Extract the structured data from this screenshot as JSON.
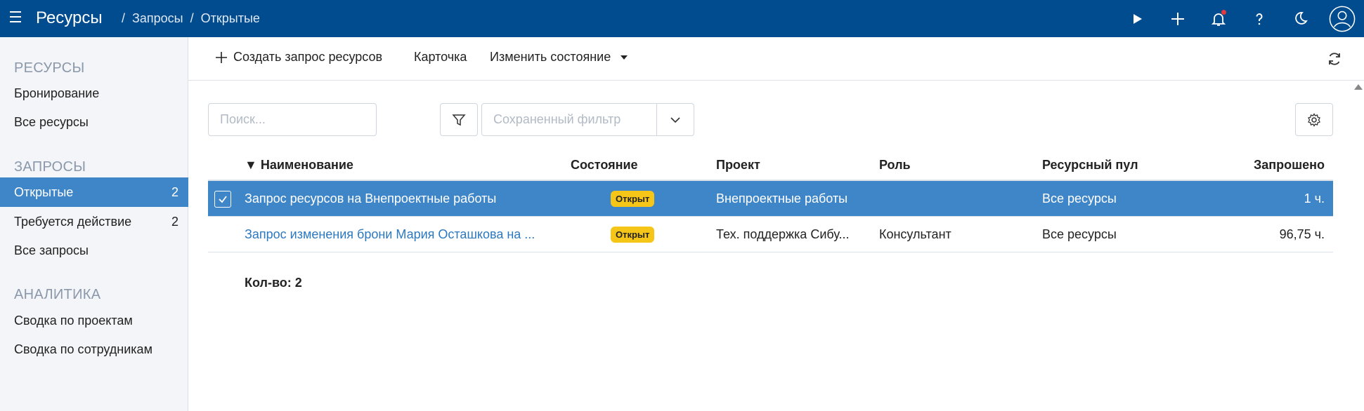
{
  "header": {
    "app_title": "Ресурсы",
    "breadcrumb": [
      "Запросы",
      "Открытые"
    ],
    "separator": "/"
  },
  "sidebar": {
    "groups": [
      {
        "title": "РЕСУРСЫ",
        "items": [
          {
            "label": "Бронирование"
          },
          {
            "label": "Все ресурсы"
          }
        ]
      },
      {
        "title": "ЗАПРОСЫ",
        "items": [
          {
            "label": "Открытые",
            "count": "2"
          },
          {
            "label": "Требуется действие",
            "count": "2"
          },
          {
            "label": "Все запросы"
          }
        ]
      },
      {
        "title": "АНАЛИТИКА",
        "items": [
          {
            "label": "Сводка по проектам"
          },
          {
            "label": "Сводка по сотрудникам"
          }
        ]
      }
    ]
  },
  "toolbar": {
    "create_label": "Создать запрос ресурсов",
    "card_label": "Карточка",
    "change_state_label": "Изменить состояние"
  },
  "filters": {
    "search_placeholder": "Поиск...",
    "saved_filter_placeholder": "Сохраненный фильтр"
  },
  "table": {
    "sort_marker": "▼",
    "columns": [
      "Наименование",
      "Состояние",
      "Проект",
      "Роль",
      "Ресурсный пул",
      "Запрошено"
    ],
    "rows": [
      {
        "name": "Запрос ресурсов на Внепроектные работы",
        "state": "Открыт",
        "project": "Внепроектные работы",
        "role": "",
        "pool": "Все ресурсы",
        "requested": "1 ч.",
        "selected": true
      },
      {
        "name": "Запрос изменения брони Мария Осташкова на ...",
        "state": "Открыт",
        "project": "Тех. поддержка Сибу...",
        "role": "Консультант",
        "pool": "Все ресурсы",
        "requested": "96,75 ч.",
        "selected": false
      }
    ],
    "total_label": "Кол-во: 2"
  },
  "colors": {
    "topbar": "#004c8f",
    "accent": "#3f86c8",
    "badge": "#f5c518",
    "link": "#2c78bf"
  }
}
